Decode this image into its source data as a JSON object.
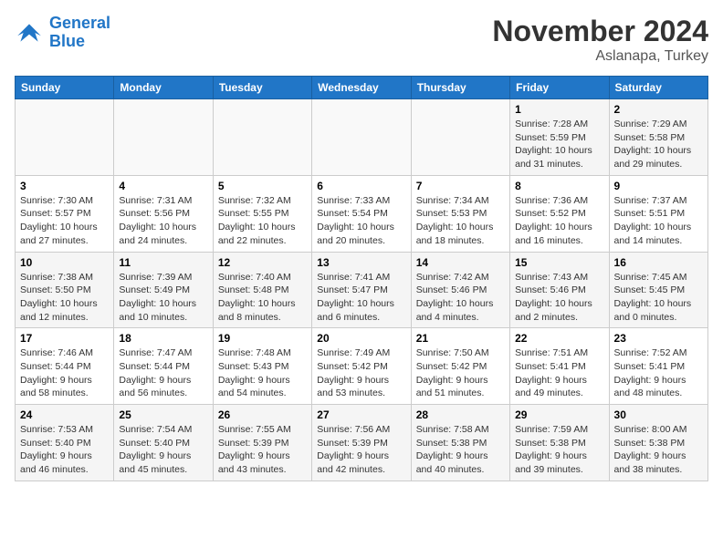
{
  "header": {
    "logo_line1": "General",
    "logo_line2": "Blue",
    "month": "November 2024",
    "location": "Aslanapa, Turkey"
  },
  "weekdays": [
    "Sunday",
    "Monday",
    "Tuesday",
    "Wednesday",
    "Thursday",
    "Friday",
    "Saturday"
  ],
  "weeks": [
    [
      {
        "day": "",
        "info": ""
      },
      {
        "day": "",
        "info": ""
      },
      {
        "day": "",
        "info": ""
      },
      {
        "day": "",
        "info": ""
      },
      {
        "day": "",
        "info": ""
      },
      {
        "day": "1",
        "info": "Sunrise: 7:28 AM\nSunset: 5:59 PM\nDaylight: 10 hours and 31 minutes."
      },
      {
        "day": "2",
        "info": "Sunrise: 7:29 AM\nSunset: 5:58 PM\nDaylight: 10 hours and 29 minutes."
      }
    ],
    [
      {
        "day": "3",
        "info": "Sunrise: 7:30 AM\nSunset: 5:57 PM\nDaylight: 10 hours and 27 minutes."
      },
      {
        "day": "4",
        "info": "Sunrise: 7:31 AM\nSunset: 5:56 PM\nDaylight: 10 hours and 24 minutes."
      },
      {
        "day": "5",
        "info": "Sunrise: 7:32 AM\nSunset: 5:55 PM\nDaylight: 10 hours and 22 minutes."
      },
      {
        "day": "6",
        "info": "Sunrise: 7:33 AM\nSunset: 5:54 PM\nDaylight: 10 hours and 20 minutes."
      },
      {
        "day": "7",
        "info": "Sunrise: 7:34 AM\nSunset: 5:53 PM\nDaylight: 10 hours and 18 minutes."
      },
      {
        "day": "8",
        "info": "Sunrise: 7:36 AM\nSunset: 5:52 PM\nDaylight: 10 hours and 16 minutes."
      },
      {
        "day": "9",
        "info": "Sunrise: 7:37 AM\nSunset: 5:51 PM\nDaylight: 10 hours and 14 minutes."
      }
    ],
    [
      {
        "day": "10",
        "info": "Sunrise: 7:38 AM\nSunset: 5:50 PM\nDaylight: 10 hours and 12 minutes."
      },
      {
        "day": "11",
        "info": "Sunrise: 7:39 AM\nSunset: 5:49 PM\nDaylight: 10 hours and 10 minutes."
      },
      {
        "day": "12",
        "info": "Sunrise: 7:40 AM\nSunset: 5:48 PM\nDaylight: 10 hours and 8 minutes."
      },
      {
        "day": "13",
        "info": "Sunrise: 7:41 AM\nSunset: 5:47 PM\nDaylight: 10 hours and 6 minutes."
      },
      {
        "day": "14",
        "info": "Sunrise: 7:42 AM\nSunset: 5:46 PM\nDaylight: 10 hours and 4 minutes."
      },
      {
        "day": "15",
        "info": "Sunrise: 7:43 AM\nSunset: 5:46 PM\nDaylight: 10 hours and 2 minutes."
      },
      {
        "day": "16",
        "info": "Sunrise: 7:45 AM\nSunset: 5:45 PM\nDaylight: 10 hours and 0 minutes."
      }
    ],
    [
      {
        "day": "17",
        "info": "Sunrise: 7:46 AM\nSunset: 5:44 PM\nDaylight: 9 hours and 58 minutes."
      },
      {
        "day": "18",
        "info": "Sunrise: 7:47 AM\nSunset: 5:44 PM\nDaylight: 9 hours and 56 minutes."
      },
      {
        "day": "19",
        "info": "Sunrise: 7:48 AM\nSunset: 5:43 PM\nDaylight: 9 hours and 54 minutes."
      },
      {
        "day": "20",
        "info": "Sunrise: 7:49 AM\nSunset: 5:42 PM\nDaylight: 9 hours and 53 minutes."
      },
      {
        "day": "21",
        "info": "Sunrise: 7:50 AM\nSunset: 5:42 PM\nDaylight: 9 hours and 51 minutes."
      },
      {
        "day": "22",
        "info": "Sunrise: 7:51 AM\nSunset: 5:41 PM\nDaylight: 9 hours and 49 minutes."
      },
      {
        "day": "23",
        "info": "Sunrise: 7:52 AM\nSunset: 5:41 PM\nDaylight: 9 hours and 48 minutes."
      }
    ],
    [
      {
        "day": "24",
        "info": "Sunrise: 7:53 AM\nSunset: 5:40 PM\nDaylight: 9 hours and 46 minutes."
      },
      {
        "day": "25",
        "info": "Sunrise: 7:54 AM\nSunset: 5:40 PM\nDaylight: 9 hours and 45 minutes."
      },
      {
        "day": "26",
        "info": "Sunrise: 7:55 AM\nSunset: 5:39 PM\nDaylight: 9 hours and 43 minutes."
      },
      {
        "day": "27",
        "info": "Sunrise: 7:56 AM\nSunset: 5:39 PM\nDaylight: 9 hours and 42 minutes."
      },
      {
        "day": "28",
        "info": "Sunrise: 7:58 AM\nSunset: 5:38 PM\nDaylight: 9 hours and 40 minutes."
      },
      {
        "day": "29",
        "info": "Sunrise: 7:59 AM\nSunset: 5:38 PM\nDaylight: 9 hours and 39 minutes."
      },
      {
        "day": "30",
        "info": "Sunrise: 8:00 AM\nSunset: 5:38 PM\nDaylight: 9 hours and 38 minutes."
      }
    ]
  ]
}
